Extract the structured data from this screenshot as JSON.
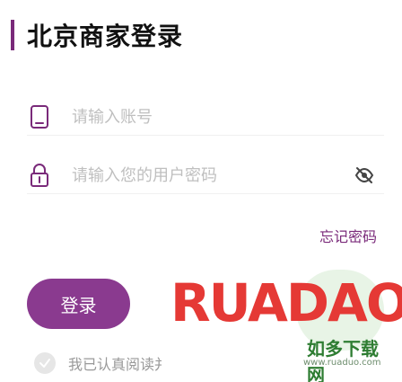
{
  "header": {
    "title": "北京商家登录"
  },
  "form": {
    "account": {
      "placeholder": "请输入账号",
      "value": ""
    },
    "password": {
      "placeholder": "请输入您的用户密码",
      "value": ""
    },
    "forgot_label": "忘记密码"
  },
  "login": {
    "label": "登录"
  },
  "agreement": {
    "text": "我已认真阅读并"
  },
  "watermark": {
    "brand": "RUADAO",
    "site_cn": "如多下载网",
    "site_url": "www.ruaduo.com"
  },
  "colors": {
    "accent": "#7a2a7a",
    "button": "#8a3a8f",
    "placeholder": "#bfbfbf"
  },
  "icons": {
    "account": "phone-icon",
    "password": "lock-icon",
    "visibility": "eye-off-icon",
    "agree": "check-circle-icon"
  }
}
